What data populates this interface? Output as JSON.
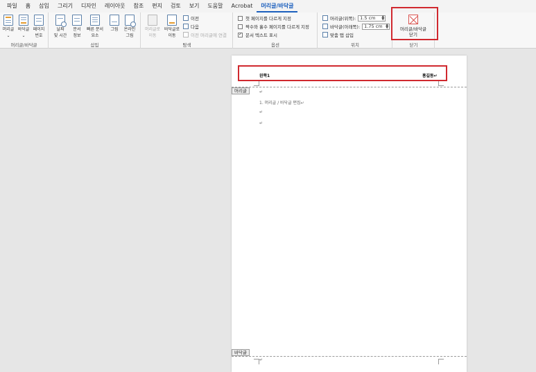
{
  "tabs": [
    "파일",
    "홈",
    "삽입",
    "그리기",
    "디자인",
    "레이아웃",
    "참조",
    "편지",
    "검토",
    "보기",
    "도움말",
    "Acrobat",
    "머리글/바닥글"
  ],
  "active_tab": "머리글/바닥글",
  "groups": {
    "header_footer": {
      "label": "머리글/바닥글",
      "header_btn": "머리글",
      "footer_btn": "바닥글",
      "page_number_btn_1": "페이지",
      "page_number_btn_2": "번호"
    },
    "insert": {
      "label": "삽입",
      "date_time_1": "날짜",
      "date_time_2": "및 시간",
      "doc_info_1": "문서",
      "doc_info_2": "정보",
      "quick_parts_1": "빠른 문서",
      "quick_parts_2": "요소",
      "pictures": "그림",
      "online_pictures_1": "온라인",
      "online_pictures_2": "그림"
    },
    "navigation": {
      "label": "탐색",
      "go_to_header_1": "머리글로",
      "go_to_header_2": "이동",
      "go_to_footer_1": "바닥글로",
      "go_to_footer_2": "이동",
      "previous": "이전",
      "next": "다음",
      "link_previous": "이전 머리글에 연결"
    },
    "options": {
      "label": "옵션",
      "different_first_page": "첫 페이지를 다르게 지정",
      "different_odd_even": "짝수와 홀수 페이지를 다르게 지정",
      "show_document_text": "문서 텍스트 표시"
    },
    "position": {
      "label": "위치",
      "header_from_top_label": "머리글(위쪽):",
      "header_from_top_value": "1.5 cm",
      "footer_from_bottom_label": "바닥글(아래쪽):",
      "footer_from_bottom_value": "1.75 cm",
      "insert_alignment_tab": "맞춤 탭 삽입"
    },
    "close": {
      "label": "닫기",
      "close_btn_1": "머리글/바닥글",
      "close_btn_2": "닫기"
    }
  },
  "document": {
    "header_left_text": "왼쪽1",
    "header_right_text": "홍길동↵",
    "header_tag": "머리글",
    "footer_tag": "바닥글",
    "para_mark": "↵",
    "body_line": "1. 머리글 / 바닥글 편집↵"
  },
  "colors": {
    "accent": "#1b5fbd",
    "highlight": "#d0282e"
  }
}
